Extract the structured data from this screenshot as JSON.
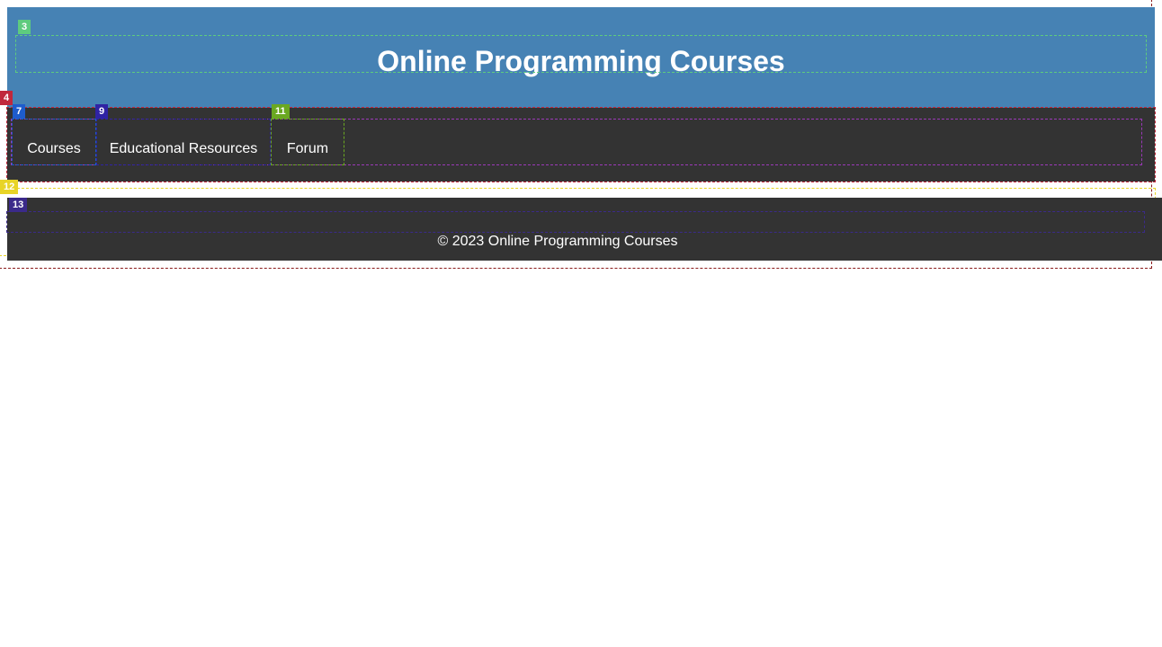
{
  "header": {
    "title": "Online Programming Courses"
  },
  "nav": {
    "items": [
      {
        "label": "Courses"
      },
      {
        "label": "Educational Resources"
      },
      {
        "label": "Forum"
      }
    ]
  },
  "footer": {
    "copyright": "© 2023 Online Programming Courses"
  },
  "annotations": {
    "badges": [
      "3",
      "4",
      "7",
      "9",
      "11",
      "12",
      "13"
    ]
  },
  "colors": {
    "header_bg": "#4682b4",
    "nav_bg": "#333333",
    "footer_bg": "#333333",
    "text": "#ffffff"
  }
}
